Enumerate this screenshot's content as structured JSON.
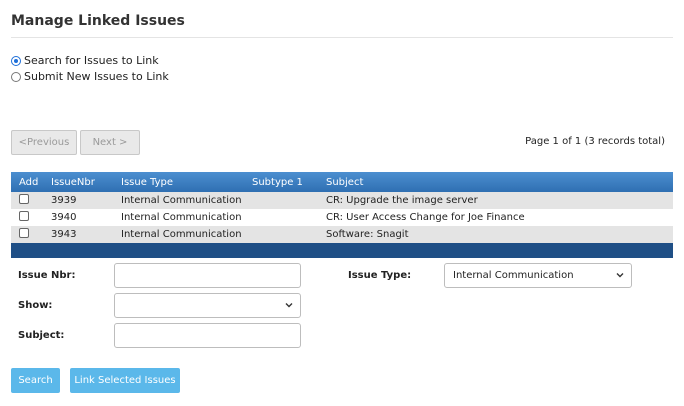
{
  "title": "Manage Linked Issues",
  "mode_options": [
    {
      "label": "Search for Issues to Link",
      "selected": true
    },
    {
      "label": "Submit New Issues to Link",
      "selected": false
    }
  ],
  "pager": {
    "previous_label": "<Previous",
    "next_label": "Next >",
    "page_info": "Page 1 of 1 (3 records total)"
  },
  "grid": {
    "headers": {
      "add": "Add",
      "issue_nbr": "IssueNbr",
      "issue_type": "Issue Type",
      "subtype1": "Subtype 1",
      "subject": "Subject"
    },
    "rows": [
      {
        "issue_nbr": "3939",
        "issue_type": "Internal Communication",
        "subtype1": "",
        "subject": "CR: Upgrade the image server",
        "checked": false
      },
      {
        "issue_nbr": "3940",
        "issue_type": "Internal Communication",
        "subtype1": "",
        "subject": "CR: User Access Change for Joe Finance",
        "checked": false
      },
      {
        "issue_nbr": "3943",
        "issue_type": "Internal Communication",
        "subtype1": "",
        "subject": "Software: Snagit",
        "checked": false
      }
    ]
  },
  "filters": {
    "issue_nbr_label": "Issue Nbr:",
    "issue_nbr_value": "",
    "issue_type_label": "Issue Type:",
    "issue_type_value": "Internal Communication",
    "show_label": "Show:",
    "show_value": "",
    "subject_label": "Subject:",
    "subject_value": ""
  },
  "actions": {
    "search_label": "Search",
    "link_label": "Link Selected Issues"
  },
  "colors": {
    "grid_header": "#3a7fc4",
    "grid_footer": "#1f4f86",
    "action_button": "#5bb8ea",
    "row_alt": "#e4e4e4"
  },
  "icons": {
    "radio": "radio-icon",
    "checkbox": "checkbox-icon",
    "dropdown": "chevron-down-icon"
  }
}
